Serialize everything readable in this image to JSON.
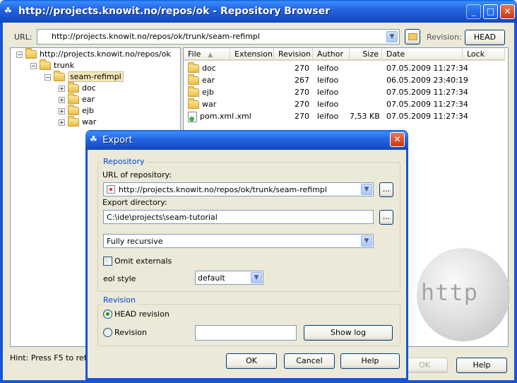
{
  "window": {
    "title": "http://projects.knowit.no/repos/ok - Repository Browser"
  },
  "toolbar": {
    "url_label": "URL:",
    "url_value": "http://projects.knowit.no/repos/ok/trunk/seam-refimpl",
    "revision_label": "Revision:",
    "revision_button": "HEAD"
  },
  "tree": [
    {
      "label": "http://projects.knowit.no/repos/ok",
      "pm": "−"
    },
    {
      "label": "trunk",
      "pm": "−"
    },
    {
      "label": "seam-refimpl",
      "pm": "−"
    },
    {
      "label": "doc",
      "pm": "+"
    },
    {
      "label": "ear",
      "pm": "+"
    },
    {
      "label": "ejb",
      "pm": "+"
    },
    {
      "label": "war",
      "pm": "+"
    }
  ],
  "list": {
    "columns": [
      "File",
      "Extension",
      "Revision",
      "Author",
      "Size",
      "Date",
      "Lock"
    ],
    "rows": [
      {
        "file": "doc",
        "ext": "",
        "rev": "270",
        "author": "leifoo",
        "size": "",
        "date": "07.05.2009 11:27:34",
        "type": "folder"
      },
      {
        "file": "ear",
        "ext": "",
        "rev": "267",
        "author": "leifoo",
        "size": "",
        "date": "06.05.2009 23:40:19",
        "type": "folder"
      },
      {
        "file": "ejb",
        "ext": "",
        "rev": "270",
        "author": "leifoo",
        "size": "",
        "date": "07.05.2009 11:27:34",
        "type": "folder"
      },
      {
        "file": "war",
        "ext": "",
        "rev": "270",
        "author": "leifoo",
        "size": "",
        "date": "07.05.2009 11:27:34",
        "type": "folder"
      },
      {
        "file": "pom.xml",
        "ext": ".xml",
        "rev": "270",
        "author": "leifoo",
        "size": "7,53 KB",
        "date": "07.05.2009 11:27:34",
        "type": "xml"
      }
    ]
  },
  "hint": "Hint: Press F5 to refre",
  "footer": {
    "ok": "OK",
    "help": "Help"
  },
  "watermark": "http",
  "export": {
    "title": "Export",
    "repository_group": "Repository",
    "url_label": "URL of repository:",
    "url_value": "http://projects.knowit.no/repos/ok/trunk/seam-refimpl",
    "dir_label": "Export directory:",
    "dir_value": "C:\\ide\\projects\\seam-tutorial",
    "browse": "...",
    "depth_value": "Fully recursive",
    "omit_externals": "Omit externals",
    "eol_label": "eol style",
    "eol_value": "default",
    "revision_group": "Revision",
    "head_revision": "HEAD revision",
    "revision": "Revision",
    "revision_value": "",
    "show_log": "Show log",
    "ok": "OK",
    "cancel": "Cancel",
    "help": "Help"
  }
}
